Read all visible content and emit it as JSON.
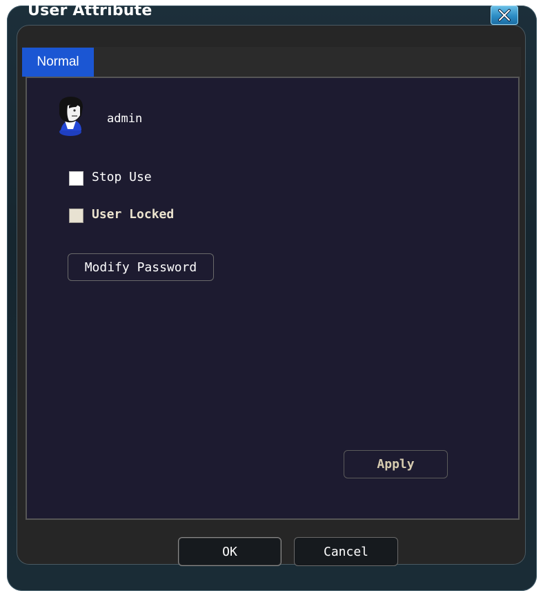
{
  "window": {
    "title": "User Attribute",
    "close_icon": "close-x-icon",
    "accent_color": "#2c8cc4"
  },
  "tabs": [
    {
      "label": "Normal",
      "active": true
    }
  ],
  "user": {
    "avatar_icon": "user-avatar-icon",
    "name": "admin"
  },
  "options": {
    "stop_use": {
      "label": "Stop Use",
      "checked": false,
      "enabled": true
    },
    "user_locked": {
      "label": "User Locked",
      "checked": false,
      "enabled": false
    }
  },
  "buttons": {
    "modify_password": "Modify Password",
    "apply": "Apply",
    "ok": "OK",
    "cancel": "Cancel"
  }
}
